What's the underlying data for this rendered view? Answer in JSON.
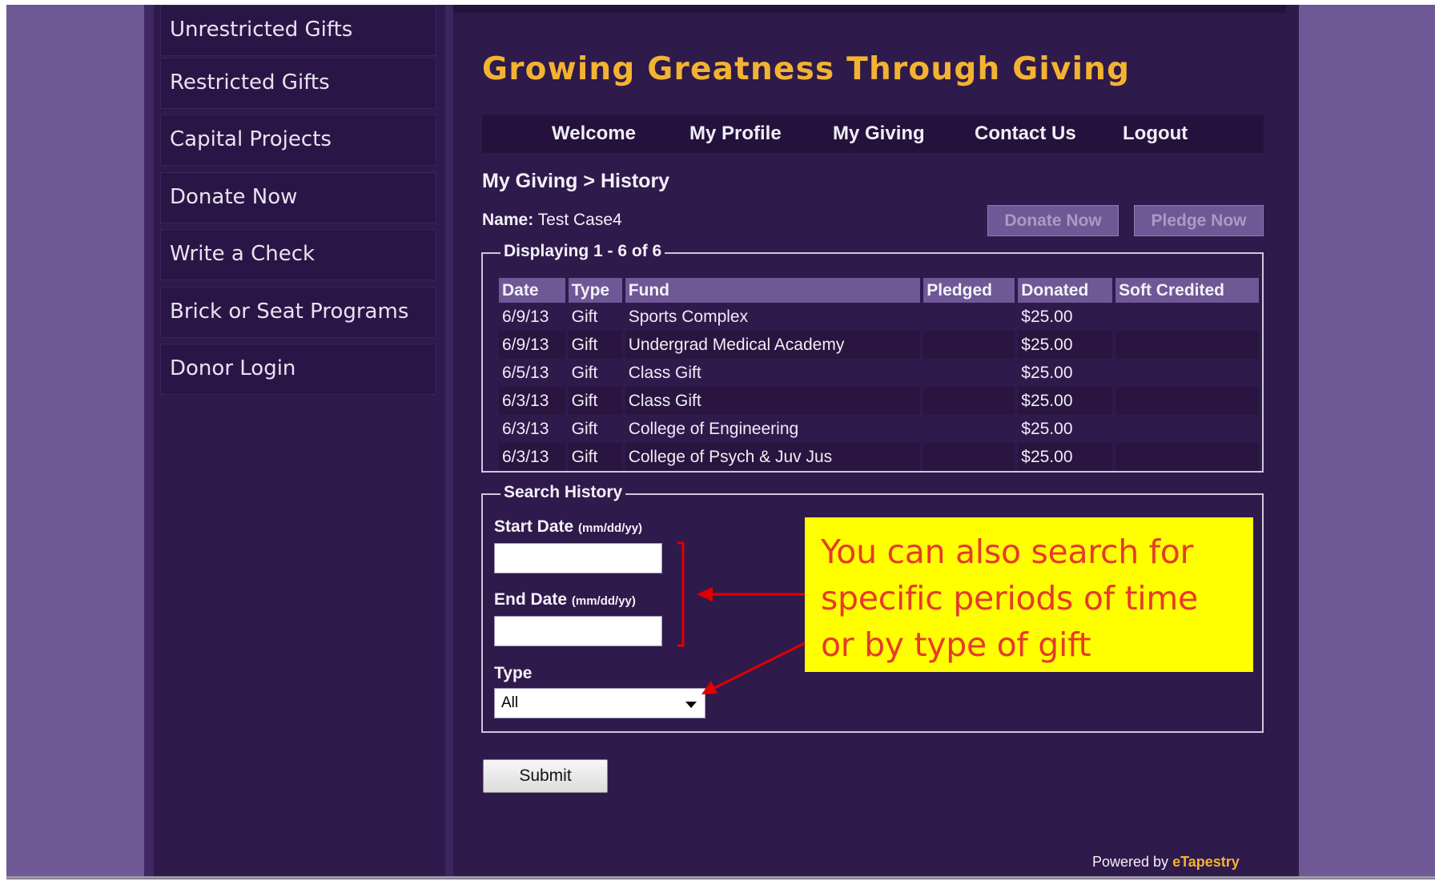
{
  "sidebar": {
    "items": [
      {
        "label": "Unrestricted Gifts"
      },
      {
        "label": "Restricted Gifts"
      },
      {
        "label": "Capital Projects"
      },
      {
        "label": "Donate Now"
      },
      {
        "label": "Write a Check"
      },
      {
        "label": "Brick or Seat Programs"
      },
      {
        "label": "Donor Login"
      }
    ]
  },
  "header": {
    "title": "Growing Greatness Through Giving",
    "nav": [
      "Welcome",
      "My Profile",
      "My Giving",
      "Contact Us",
      "Logout"
    ]
  },
  "breadcrumb": "My Giving > History",
  "name": {
    "label": "Name:",
    "value": "Test Case4"
  },
  "actions": {
    "donate": "Donate Now",
    "pledge": "Pledge Now"
  },
  "history": {
    "legend": "Displaying 1 - 6 of 6",
    "columns": [
      "Date",
      "Type",
      "Fund",
      "Pledged",
      "Donated",
      "Soft Credited"
    ],
    "rows": [
      [
        "6/9/13",
        "Gift",
        "Sports Complex",
        "",
        "$25.00",
        ""
      ],
      [
        "6/9/13",
        "Gift",
        "Undergrad Medical Academy",
        "",
        "$25.00",
        ""
      ],
      [
        "6/5/13",
        "Gift",
        "Class Gift",
        "",
        "$25.00",
        ""
      ],
      [
        "6/3/13",
        "Gift",
        "Class Gift",
        "",
        "$25.00",
        ""
      ],
      [
        "6/3/13",
        "Gift",
        "College of Engineering",
        "",
        "$25.00",
        ""
      ],
      [
        "6/3/13",
        "Gift",
        "College of Psych & Juv Jus",
        "",
        "$25.00",
        ""
      ]
    ]
  },
  "search": {
    "legend": "Search History",
    "start_label": "Start Date",
    "end_label": "End Date",
    "date_hint": "(mm/dd/yy)",
    "start_value": "",
    "end_value": "",
    "type_label": "Type",
    "type_value": "All",
    "submit": "Submit"
  },
  "callout": "You can also search for specific periods of time or by type of gift",
  "footer": {
    "prefix": "Powered by",
    "brand": "eTapestry"
  },
  "colors": {
    "background": "#6e5895",
    "page": "#2f1a4c",
    "title": "#f3b331",
    "table_header": "#6e5895",
    "callout_bg": "#ffff00",
    "callout_text": "#e53b2a",
    "arrow": "#e00000"
  }
}
